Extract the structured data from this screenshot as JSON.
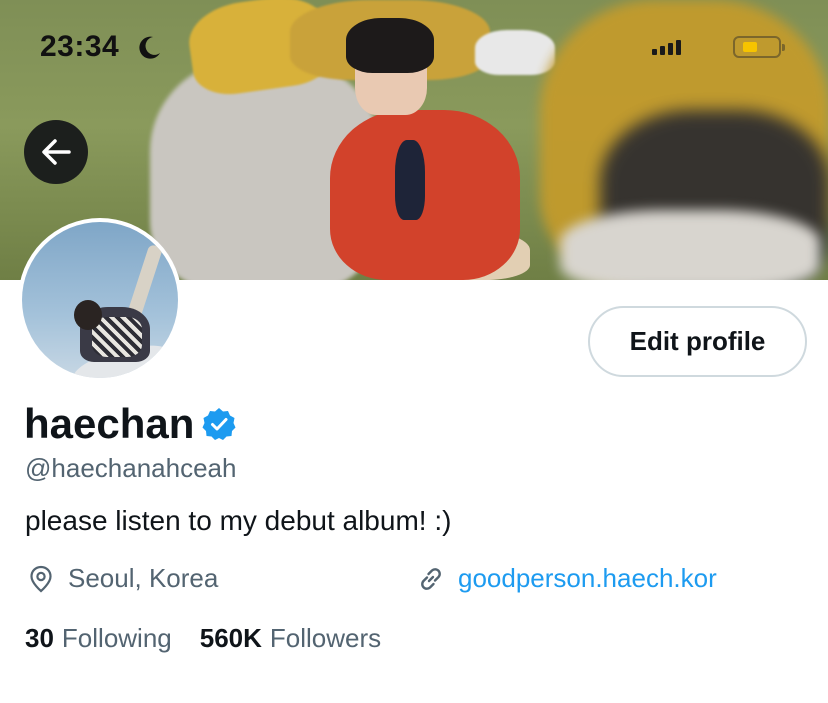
{
  "status_bar": {
    "time": "23:34",
    "icons": [
      "moon-icon",
      "signal-icon",
      "battery-icon"
    ],
    "battery_color": "#f6c400"
  },
  "profile": {
    "display_name": "haechan",
    "verified": true,
    "handle": "@haechanahceah",
    "bio": "please listen to my debut album! :)",
    "location": "Seoul, Korea",
    "website": "goodperson.haech.kor",
    "following_count": "30",
    "following_label": "Following",
    "followers_count": "560K",
    "followers_label": "Followers"
  },
  "actions": {
    "edit_profile_label": "Edit profile"
  },
  "colors": {
    "accent": "#1d9bf0",
    "text_primary": "#0f1419",
    "text_secondary": "#536471",
    "button_border": "#cfd9de"
  }
}
